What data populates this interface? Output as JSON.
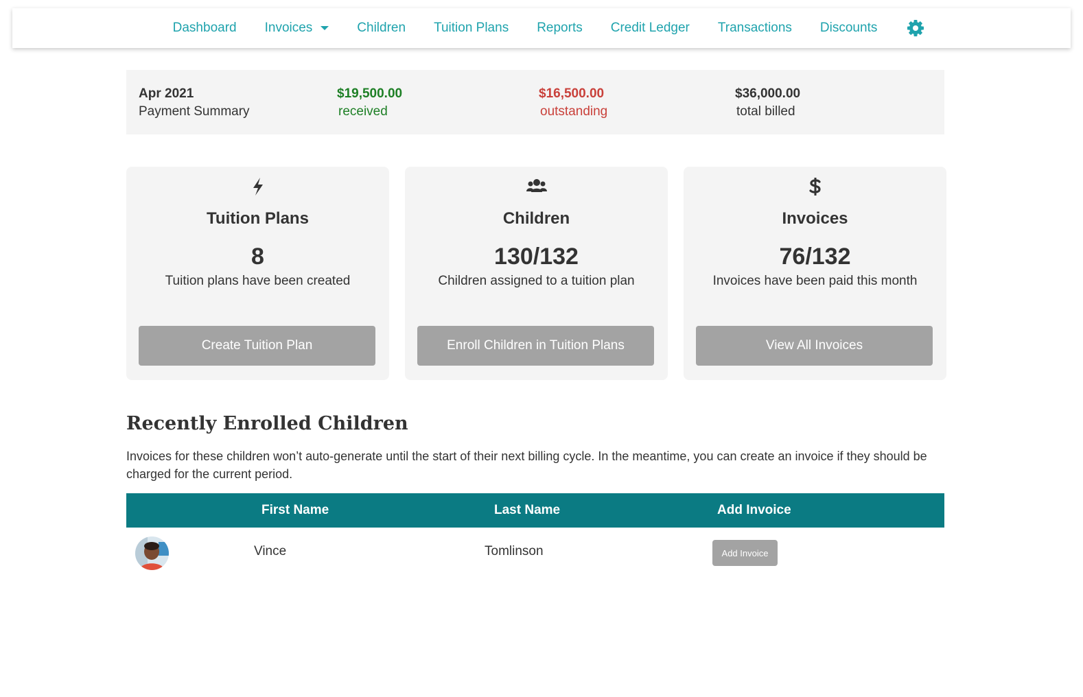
{
  "nav": {
    "items": [
      {
        "label": "Dashboard"
      },
      {
        "label": "Invoices"
      },
      {
        "label": "Children"
      },
      {
        "label": "Tuition Plans"
      },
      {
        "label": "Reports"
      },
      {
        "label": "Credit Ledger"
      },
      {
        "label": "Transactions"
      },
      {
        "label": "Discounts"
      }
    ],
    "settings_icon": "gear-icon",
    "dropdown_icon": "caret-down-icon"
  },
  "summary": {
    "period": "Apr 2021",
    "title": "Payment Summary",
    "received_amount": "$19,500.00",
    "received_label": "received",
    "outstanding_amount": "$16,500.00",
    "outstanding_label": "outstanding",
    "billed_amount": "$36,000.00",
    "billed_label": "total billed"
  },
  "cards": [
    {
      "icon": "bolt-icon",
      "title": "Tuition Plans",
      "stat": "8",
      "description": "Tuition plans have been created",
      "button": "Create Tuition Plan"
    },
    {
      "icon": "users-icon",
      "title": "Children",
      "stat": "130/132",
      "description": "Children assigned to a tuition plan",
      "button": "Enroll Children in Tuition Plans"
    },
    {
      "icon": "dollar-icon",
      "title": "Invoices",
      "stat": "76/132",
      "description": "Invoices have been paid this month",
      "button": "View All Invoices"
    }
  ],
  "recent": {
    "title": "Recently Enrolled Children",
    "description": "Invoices for these children won’t auto-generate until the start of their next billing cycle. In the meantime, you can create an invoice if they should be charged for the current period.",
    "columns": [
      "First Name",
      "Last Name",
      "Add Invoice"
    ],
    "rows": [
      {
        "first_name": "Vince",
        "last_name": "Tomlinson",
        "action": "Add Invoice"
      }
    ]
  },
  "colors": {
    "accent": "#1fa3ad",
    "table_header": "#0b7b83",
    "received": "#1d7f25",
    "outstanding": "#c9403a",
    "button": "#a3a3a3",
    "panel": "#f4f4f4"
  }
}
